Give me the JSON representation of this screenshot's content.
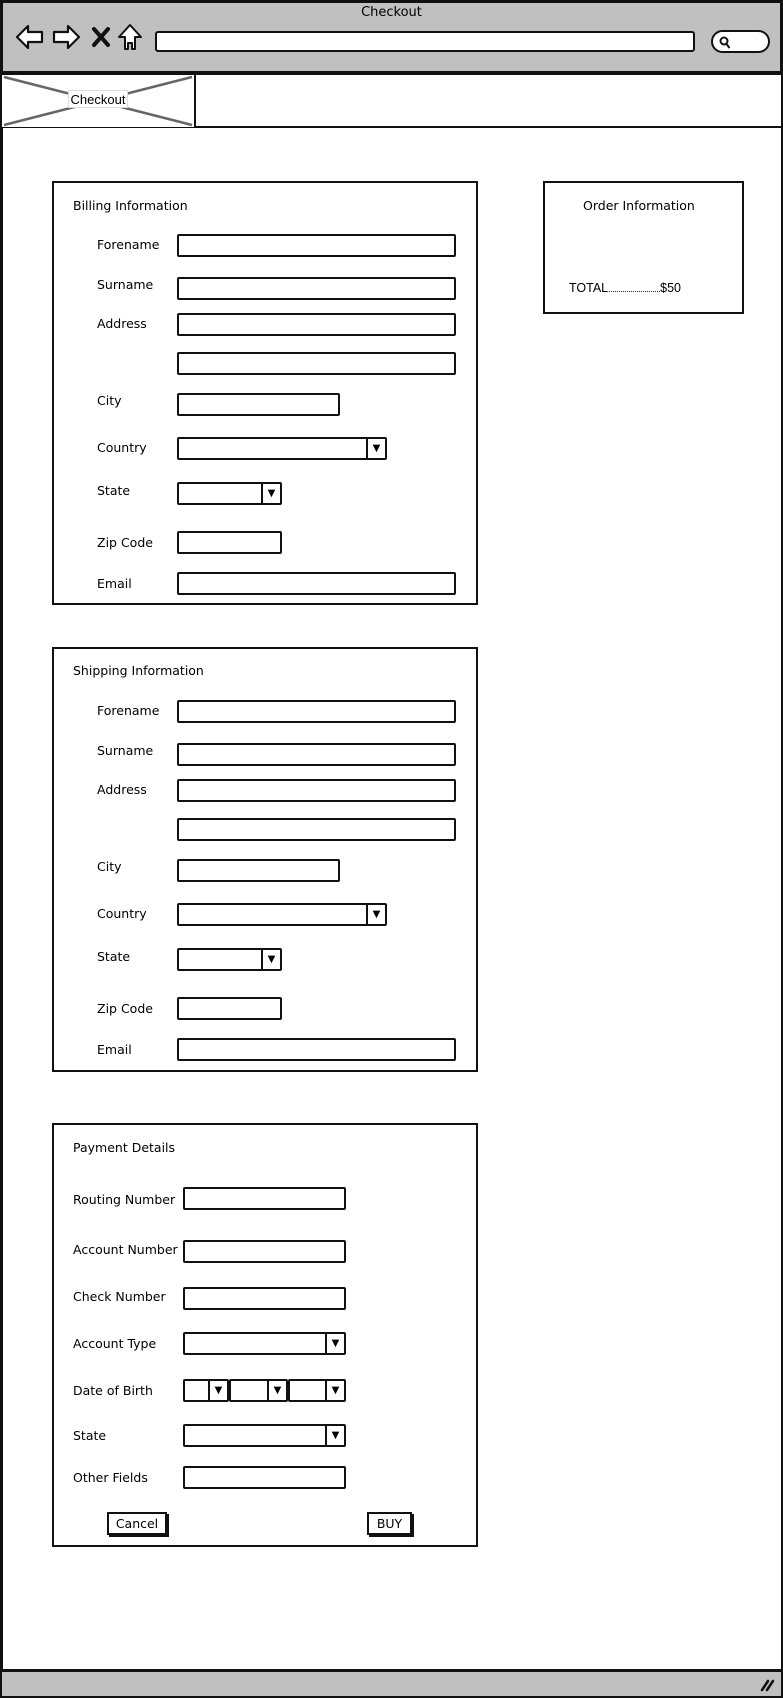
{
  "window": {
    "title": "Checkout",
    "nav": {
      "back_icon": "back-arrow-icon",
      "forward_icon": "forward-arrow-icon",
      "stop_icon": "close-icon",
      "home_icon": "home-icon",
      "search_icon": "search-icon"
    },
    "url_value": ""
  },
  "tab": {
    "label": "Checkout"
  },
  "billing": {
    "title": "Billing Information",
    "fields": {
      "forename": "Forename",
      "surname": "Surname",
      "address": "Address",
      "city": "City",
      "country": "Country",
      "state": "State",
      "zip": "Zip Code",
      "email": "Email"
    }
  },
  "shipping": {
    "title": "Shipping Information",
    "fields": {
      "forename": "Forename",
      "surname": "Surname",
      "address": "Address",
      "city": "City",
      "country": "Country",
      "state": "State",
      "zip": "Zip Code",
      "email": "Email"
    }
  },
  "order": {
    "title": "Order Information",
    "total_label": "TOTAL",
    "total_leader": "..........................",
    "total_value": "$50"
  },
  "payment": {
    "title": "Payment Details",
    "fields": {
      "routing": "Routing Number",
      "account": "Account Number",
      "check": "Check Number",
      "account_type": "Account Type",
      "dob": "Date of Birth",
      "state": "State",
      "other": "Other Fields"
    },
    "cancel_label": "Cancel",
    "buy_label": "BUY"
  },
  "dropdown_arrow": "▼"
}
